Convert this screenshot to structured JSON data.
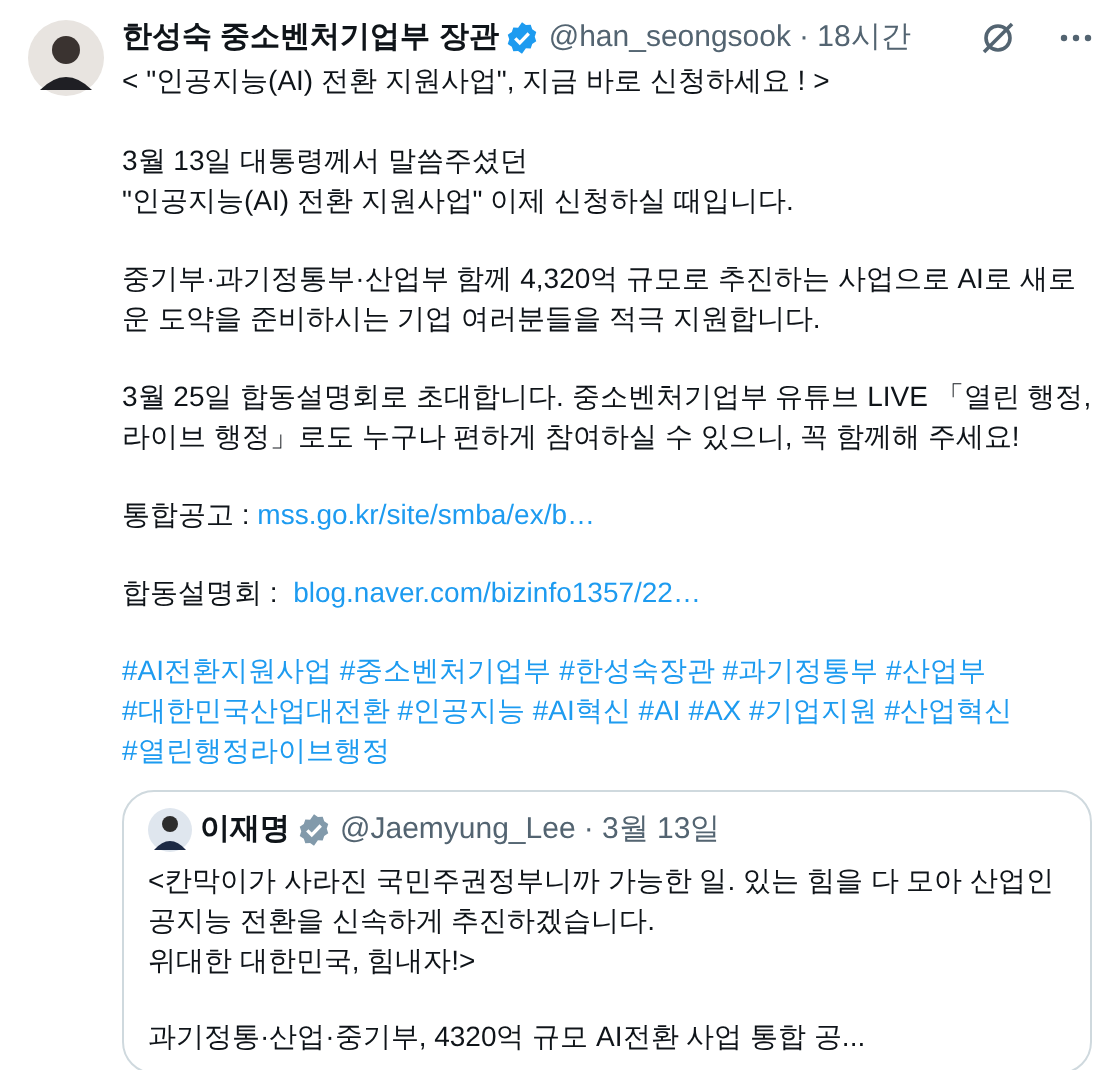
{
  "author": {
    "name": "한성숙 중소벤처기업부 장관",
    "verified": true,
    "handle": "@han_seongsook",
    "time": "· 18시간"
  },
  "title": "< \"인공지능(AI) 전환 지원사업\", 지금 바로 신청하세요 ! >",
  "paragraphs": [
    {
      "kind": "text",
      "text": "3월 13일 대통령께서 말씀주셨던\n\"인공지능(AI) 전환 지원사업\" 이제 신청하실 때입니다."
    },
    {
      "kind": "text",
      "text": "중기부·과기정통부·산업부 함께 4,320억 규모로 추진하는 사업으로 AI로 새로운 도약을 준비하시는 기업 여러분들을 적극 지원합니다."
    },
    {
      "kind": "text",
      "text": "3월 25일 합동설명회로 초대합니다. 중소벤처기업부 유튜브 LIVE 「열린 행정, 라이브 행정」로도 누구나 편하게 참여하실 수 있으니, 꼭 함께해 주세요!"
    },
    {
      "kind": "link",
      "text": "통합공고 : ",
      "link": "mss.go.kr/site/smba/ex/b…"
    },
    {
      "kind": "link",
      "text": "합동설명회 :  ",
      "link": "blog.naver.com/bizinfo1357/22…"
    }
  ],
  "hashtags": [
    "#AI전환지원사업",
    "#중소벤처기업부",
    "#한성숙장관",
    "#과기정통부",
    "#산업부",
    "#대한민국산업대전환",
    "#인공지능",
    "#AI혁신",
    "#AI",
    "#AX",
    "#기업지원",
    "#산업혁신",
    "#열린행정라이브행정"
  ],
  "quoted": {
    "name": "이재명",
    "verified": true,
    "handle": "@Jaemyung_Lee",
    "time": "· 3월 13일",
    "paragraphs": [
      "<칸막이가 사라진 국민주권정부니까 가능한 일. 있는 힘을 다 모아 산업인공지능 전환을 신속하게 추진하겠습니다.\n위대한 대한민국, 힘내자!>",
      "과기정통·산업·중기부, 4320억 규모 AI전환 사업 통합 공..."
    ]
  }
}
